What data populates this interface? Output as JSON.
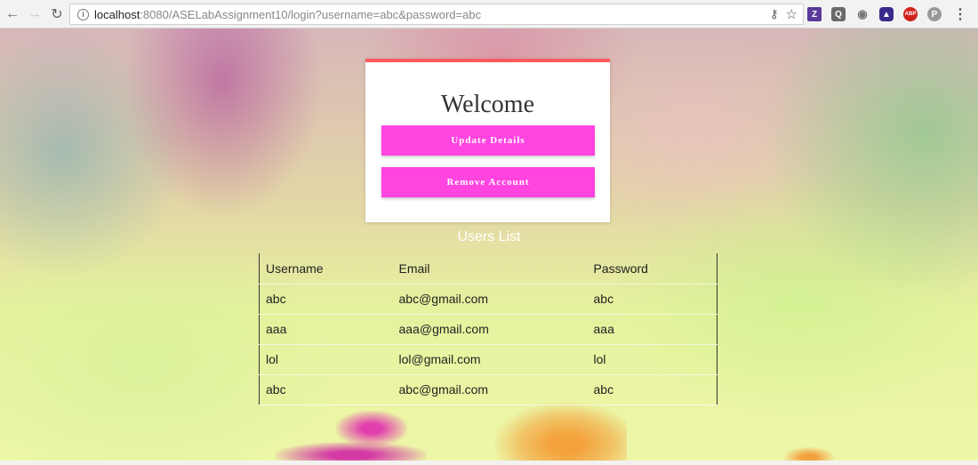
{
  "browser": {
    "url_host": "localhost",
    "url_rest": ":8080/ASELabAssignment10/login?username=abc&password=abc",
    "nav_icons": [
      "back-icon",
      "forward-icon",
      "reload-icon"
    ],
    "extensions": [
      {
        "name": "zotero-icon",
        "label": "Z"
      },
      {
        "name": "q-icon",
        "label": "Q"
      },
      {
        "name": "camera-icon",
        "label": "📷"
      },
      {
        "name": "bug-icon",
        "label": "🐞"
      },
      {
        "name": "adblock-icon",
        "label": "ABP"
      },
      {
        "name": "p-icon",
        "label": "P"
      }
    ]
  },
  "card": {
    "title": "Welcome",
    "update_label": "Update Details",
    "remove_label": "Remove Account"
  },
  "users": {
    "title": "Users List",
    "headers": [
      "Username",
      "Email",
      "Password"
    ],
    "rows": [
      [
        "abc",
        "abc@gmail.com",
        "abc"
      ],
      [
        "aaa",
        "aaa@gmail.com",
        "aaa"
      ],
      [
        "lol",
        "lol@gmail.com",
        "lol"
      ],
      [
        "abc",
        "abc@gmail.com",
        "abc"
      ]
    ]
  },
  "colors": {
    "button": "#ff44e0",
    "card_accent": "#ff5a5f"
  }
}
